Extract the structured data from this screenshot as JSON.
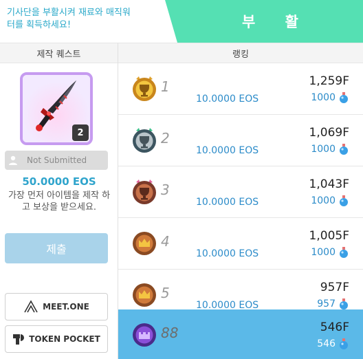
{
  "banner": {
    "message": "기사단을 부활시켜 재료와 매직워터를 획득하세요!",
    "title": "부 활"
  },
  "quest": {
    "header": "제작 퀘스트",
    "item_count": "2",
    "status": "Not Submitted",
    "reward": "50.0000 EOS",
    "description": "가장 먼저 아이템을 제작 하고 보상을 받으세요.",
    "submit_label": "제출",
    "wallets": {
      "meetone": "MEET.ONE",
      "tokenpocket": "TOKEN POCKET"
    }
  },
  "ranking": {
    "header": "랭킹",
    "rows": [
      {
        "rank": "1",
        "medal": "gold-trophy-icon",
        "eos": "10.0000 EOS",
        "score": "1,259F",
        "water": "1000"
      },
      {
        "rank": "2",
        "medal": "silver-trophy-icon",
        "eos": "10.0000 EOS",
        "score": "1,069F",
        "water": "1000"
      },
      {
        "rank": "3",
        "medal": "bronze-trophy-icon",
        "eos": "10.0000 EOS",
        "score": "1,043F",
        "water": "1000"
      },
      {
        "rank": "4",
        "medal": "crown-medal-icon",
        "eos": "10.0000 EOS",
        "score": "1,005F",
        "water": "1000"
      },
      {
        "rank": "5",
        "medal": "crown-medal-icon",
        "eos": "10.0000 EOS",
        "score": "957F",
        "water": "957"
      }
    ],
    "me": {
      "rank": "88",
      "medal": "purple-castle-icon",
      "score": "546F",
      "water": "546"
    }
  },
  "colors": {
    "banner_green": "#55e0b3",
    "accent_blue": "#2b8bc9",
    "highlight_row": "#5bb9e8",
    "submit_button": "#a9d3ea",
    "item_border": "#c69bf0"
  }
}
